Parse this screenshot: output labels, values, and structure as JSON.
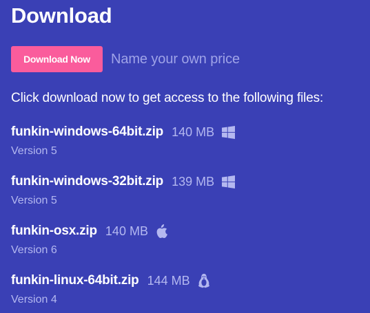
{
  "page": {
    "title": "Download"
  },
  "purchase": {
    "button_label": "Download Now",
    "price_note": "Name your own price"
  },
  "intro": "Click download now to get access to the following files:",
  "files": [
    {
      "name": "funkin-windows-64bit.zip",
      "size": "140 MB",
      "platform_icon": "windows-icon",
      "version": "Version 5"
    },
    {
      "name": "funkin-windows-32bit.zip",
      "size": "139 MB",
      "platform_icon": "windows-icon",
      "version": "Version 5"
    },
    {
      "name": "funkin-osx.zip",
      "size": "140 MB",
      "platform_icon": "apple-icon",
      "version": "Version 6"
    },
    {
      "name": "funkin-linux-64bit.zip",
      "size": "144 MB",
      "platform_icon": "linux-icon",
      "version": "Version 4"
    }
  ],
  "colors": {
    "background": "#3a40b5",
    "button": "#fa5c9c",
    "muted_text": "#b4b8f0",
    "placeholder_text": "#9fa3e8"
  }
}
